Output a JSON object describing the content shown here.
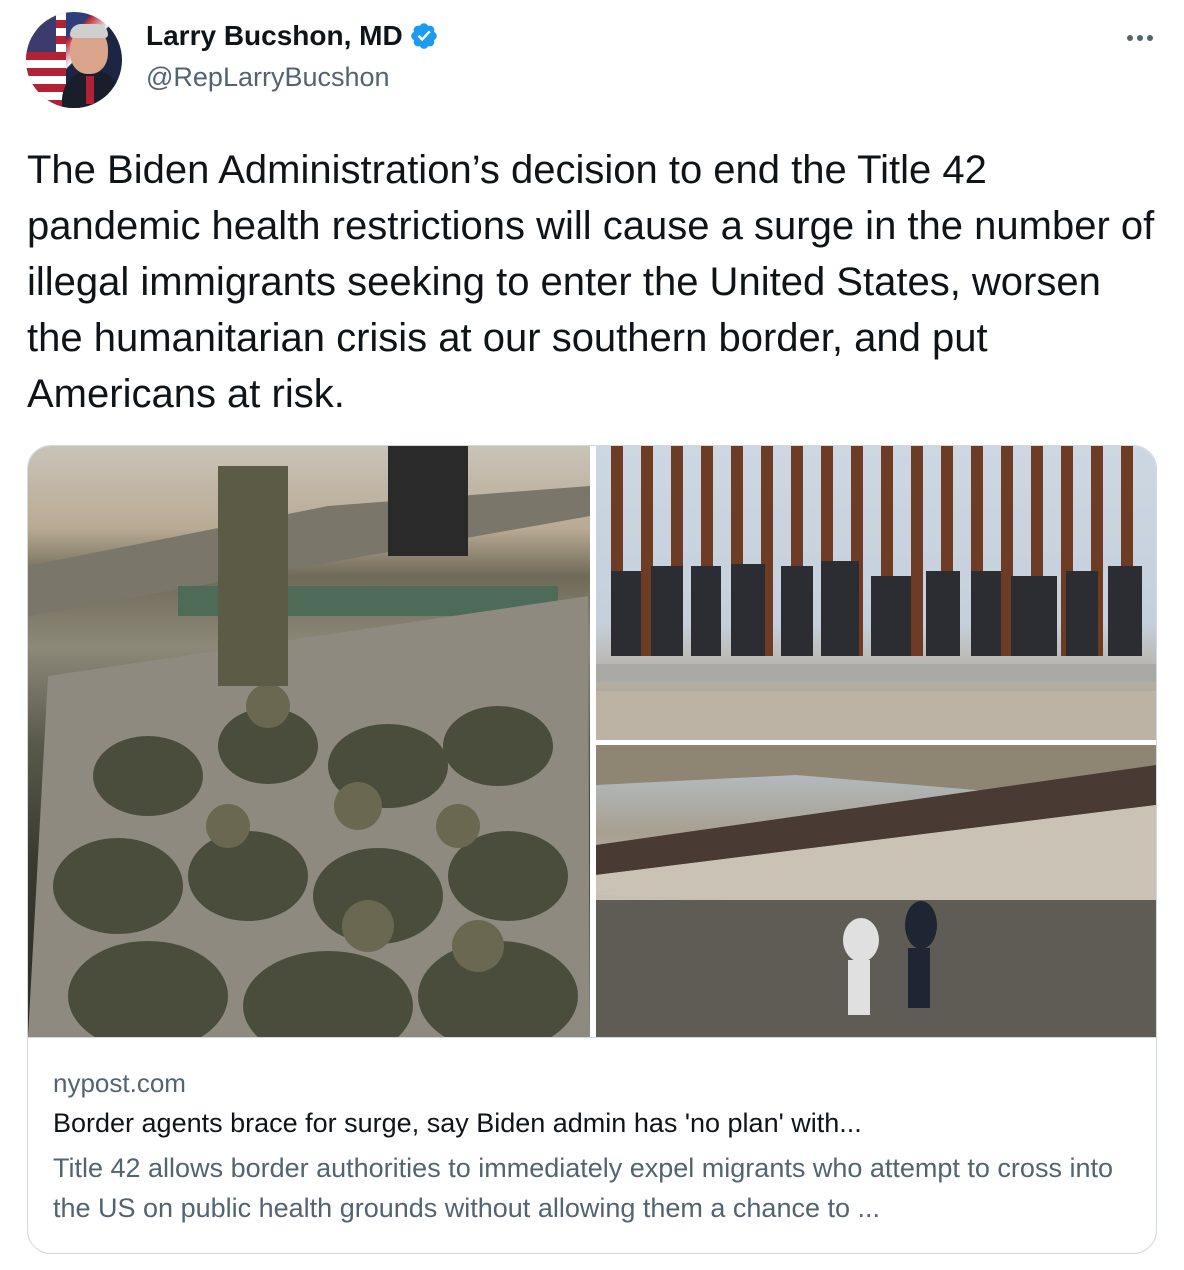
{
  "author": {
    "display_name": "Larry Bucshon, MD",
    "handle": "@RepLarryBucshon",
    "verified": true,
    "avatar_icon": "profile-photo"
  },
  "tweet": {
    "text": "The Biden Administration’s decision to end the Title 42 pandemic health restrictions will cause a surge in the number of illegal immigrants seeking to enter the United States, worsen the humanitarian crisis at our southern border, and put Americans at risk."
  },
  "menu": {
    "more_icon": "more-horizontal-icon"
  },
  "link_card": {
    "domain": "nypost.com",
    "title": "Border agents brace for surge, say Biden admin has 'no plan' with...",
    "description": "Title 42 allows border authorities to immediately expel migrants who attempt to cross into the US on public health grounds without allowing them a chance to ...",
    "images": [
      {
        "name": "truck-photo"
      },
      {
        "name": "border-wall-photo"
      },
      {
        "name": "river-crossing-photo"
      }
    ]
  },
  "colors": {
    "text_primary": "#0f1419",
    "text_secondary": "#536471",
    "verified_badge": "#1d9bf0",
    "border": "#cfd9de"
  }
}
